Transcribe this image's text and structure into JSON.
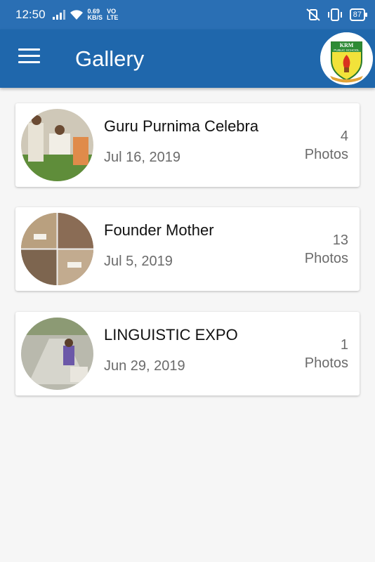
{
  "status_bar": {
    "time": "12:50",
    "net_speed_value": "0.69",
    "net_speed_unit": "KB/S",
    "volte_top": "VO",
    "volte_bottom": "LTE",
    "battery": "87"
  },
  "app_bar": {
    "title": "Gallery",
    "logo_text_top": "KRM",
    "logo_text_sub": "PUBLIC SCHOOL"
  },
  "albums": [
    {
      "title": "Guru Purnima Celebra",
      "date": "Jul 16, 2019",
      "count": "4",
      "count_label": "Photos"
    },
    {
      "title": "Founder Mother",
      "date": "Jul 5, 2019",
      "count": "13",
      "count_label": "Photos"
    },
    {
      "title": "LINGUISTIC EXPO",
      "date": "Jun 29, 2019",
      "count": "1",
      "count_label": "Photos"
    }
  ],
  "colors": {
    "status_bar": "#2a6fb4",
    "app_bar": "#1f67ac",
    "background": "#f6f6f6"
  },
  "icons": [
    "signal-icon",
    "wifi-icon",
    "vibrate-off-icon",
    "vibrate-icon",
    "battery-icon",
    "menu-icon"
  ]
}
